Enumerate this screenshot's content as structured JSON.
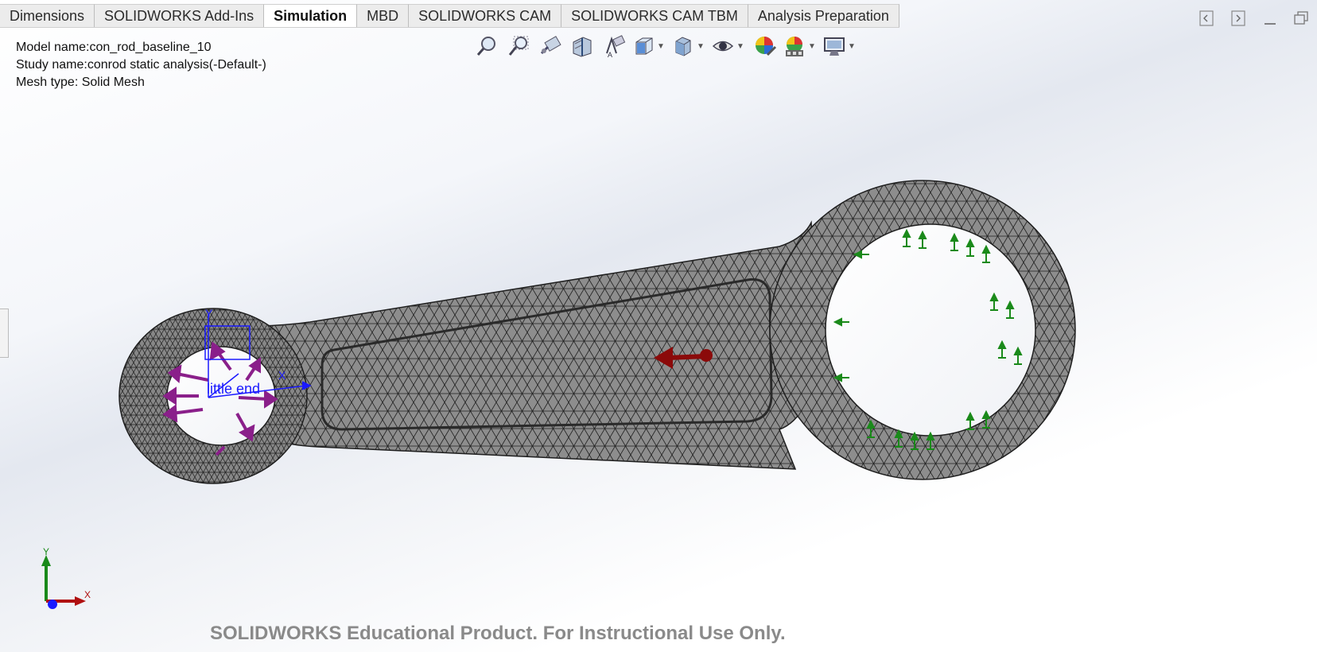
{
  "tabs": [
    {
      "label": "Dimensions",
      "active": false
    },
    {
      "label": "SOLIDWORKS Add-Ins",
      "active": false
    },
    {
      "label": "Simulation",
      "active": true
    },
    {
      "label": "MBD",
      "active": false
    },
    {
      "label": "SOLIDWORKS CAM",
      "active": false
    },
    {
      "label": "SOLIDWORKS CAM TBM",
      "active": false
    },
    {
      "label": "Analysis Preparation",
      "active": false
    }
  ],
  "info": {
    "model": "Model name:con_rod_baseline_10",
    "study": "Study name:conrod static analysis(-Default-)",
    "mesh": "Mesh type: Solid Mesh"
  },
  "toolbar": [
    {
      "name": "zoom-to-fit-icon",
      "dropdown": false
    },
    {
      "name": "zoom-to-area-icon",
      "dropdown": false
    },
    {
      "name": "previous-view-icon",
      "dropdown": false
    },
    {
      "name": "section-view-icon",
      "dropdown": false
    },
    {
      "name": "dynamic-annotation-views-icon",
      "dropdown": false
    },
    {
      "name": "view-orientation-icon",
      "dropdown": true
    },
    {
      "name": "display-style-icon",
      "dropdown": true
    },
    {
      "name": "hide-show-items-icon",
      "dropdown": true
    },
    {
      "name": "edit-appearance-icon",
      "dropdown": false
    },
    {
      "name": "apply-scene-icon",
      "dropdown": true
    },
    {
      "name": "view-settings-icon",
      "dropdown": true
    }
  ],
  "window_controls": [
    "tile-left-icon",
    "tile-right-icon",
    "minimize-icon",
    "restore-icon"
  ],
  "model_annotation": "little end",
  "axis_labels": {
    "x": "X",
    "y": "Y"
  },
  "watermark": "SOLIDWORKS Educational Product. For Instructional Use Only.",
  "colors": {
    "mesh_fill": "#8a8a8a",
    "mesh_line": "#1e1e1e",
    "fixture": "#1a8a1a",
    "load": "#8b0a0a",
    "bearing_load": "#8a1f8a",
    "coord_sys": "#1a1aff"
  }
}
